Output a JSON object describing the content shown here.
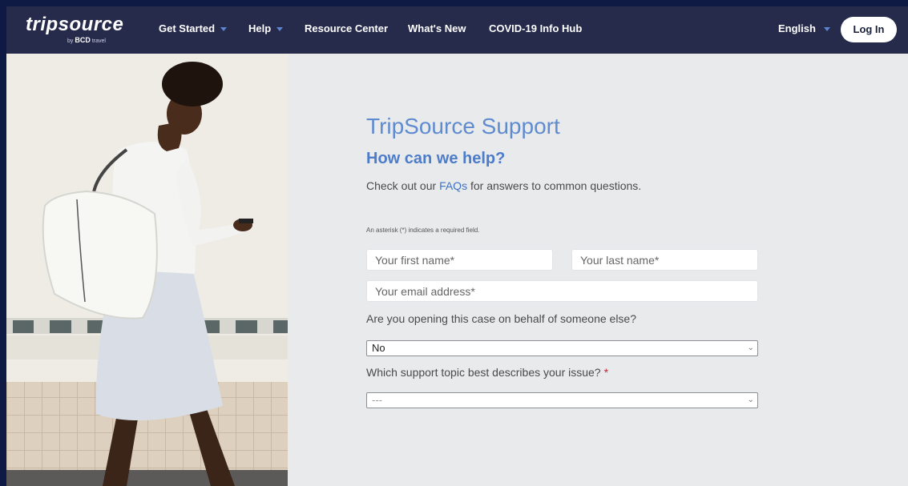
{
  "nav": {
    "logo": "tripsource",
    "logo_sub_by": "by",
    "logo_sub_brand": "BCD",
    "logo_sub_travel": "travel",
    "items": [
      {
        "label": "Get Started",
        "dropdown": true
      },
      {
        "label": "Help",
        "dropdown": true
      },
      {
        "label": "Resource Center",
        "dropdown": false
      },
      {
        "label": "What's New",
        "dropdown": false
      },
      {
        "label": "COVID-19 Info Hub",
        "dropdown": false
      }
    ],
    "language": "English",
    "login": "Log In"
  },
  "support": {
    "title": "TripSource Support",
    "heading": "How can we help?",
    "faq_prefix": "Check out our ",
    "faq_link": "FAQs",
    "faq_suffix": " for answers to common questions.",
    "required_note": "An asterisk (*) indicates a required field.",
    "first_name_placeholder": "Your first name*",
    "last_name_placeholder": "Your last name*",
    "email_placeholder": "Your email address*",
    "behalf_question": "Are you opening this case on behalf of someone else?",
    "behalf_value": "No",
    "topic_question": "Which support topic best describes your issue?",
    "topic_required": "*",
    "topic_value": "---"
  },
  "colors": {
    "nav_bg": "#262a4b",
    "accent_blue": "#4d7cc8",
    "required_red": "#c0293b"
  },
  "icons": {
    "dropdown_caret": "caret-down-icon",
    "select_chevron": "chevron-down-icon"
  }
}
